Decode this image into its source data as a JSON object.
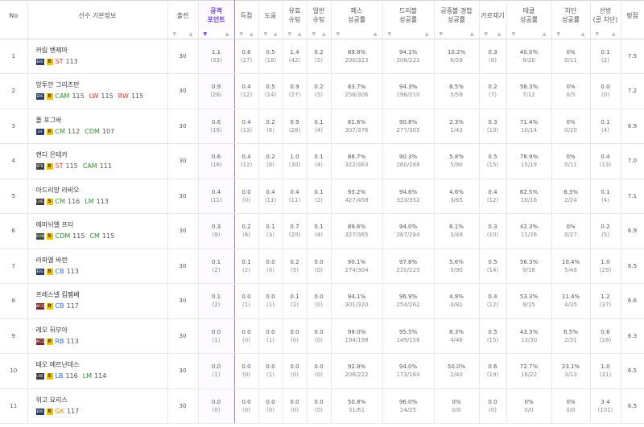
{
  "headers": {
    "no": "No",
    "player": "선수 기본정보",
    "apps": "출전",
    "attack_points": [
      "공격",
      "포인트"
    ],
    "goals": "득점",
    "assists": "도움",
    "shots_on": [
      "유효",
      "슈팅"
    ],
    "shots": [
      "일반",
      "슈팅"
    ],
    "pass": [
      "패스",
      "성공률"
    ],
    "dribble": [
      "드리블",
      "성공률"
    ],
    "aerial": [
      "공중볼 경합",
      "성공률"
    ],
    "intercept": "가로채기",
    "tackle": [
      "태클",
      "성공률"
    ],
    "block": [
      "차단",
      "성공률"
    ],
    "defense": [
      "선방",
      "(골 차단)"
    ],
    "rating": "평점"
  },
  "rows": [
    {
      "no": "1",
      "name": "카림 벤제마",
      "team": "EBS",
      "num": "8",
      "positions": [
        {
          "pos": "ST",
          "ovr": "113",
          "cls": "pos-st"
        }
      ],
      "apps": "30",
      "ap": [
        "1.1",
        "(33)"
      ],
      "g": [
        "0.6",
        "(17)"
      ],
      "a": [
        "0.5",
        "(16)"
      ],
      "so": [
        "1.4",
        "(42)"
      ],
      "s": [
        "0.2",
        "(5)"
      ],
      "pass": [
        "89.8%",
        "290/323"
      ],
      "drb": [
        "94.1%",
        "208/221"
      ],
      "aer": [
        "10.2%",
        "6/59"
      ],
      "int": [
        "0.3",
        "(8)"
      ],
      "tkl": [
        "40.0%",
        "8/20"
      ],
      "blk": [
        "0%",
        "0/11"
      ],
      "def": [
        "0.1",
        "(2)"
      ],
      "rating": "7.5"
    },
    {
      "no": "2",
      "name": "앙투안 그리즈만",
      "team": "EBS",
      "num": "8",
      "positions": [
        {
          "pos": "CAM",
          "ovr": "115",
          "cls": "pos-cm"
        },
        {
          "pos": "LW",
          "ovr": "115",
          "cls": "pos-lw"
        },
        {
          "pos": "RW",
          "ovr": "115",
          "cls": "pos-rw"
        }
      ],
      "apps": "30",
      "ap": [
        "0.9",
        "(26)"
      ],
      "g": [
        "0.4",
        "(12)"
      ],
      "a": [
        "0.5",
        "(14)"
      ],
      "so": [
        "0.9",
        "(27)"
      ],
      "s": [
        "0.2",
        "(5)"
      ],
      "pass": [
        "83.7%",
        "256/306"
      ],
      "drb": [
        "94.3%",
        "198/210"
      ],
      "aer": [
        "8.5%",
        "5/59"
      ],
      "int": [
        "0.2",
        "(7)"
      ],
      "tkl": [
        "58.3%",
        "7/12"
      ],
      "blk": [
        "0%",
        "0/5"
      ],
      "def": [
        "0.0",
        "(0)"
      ],
      "rating": "7.2"
    },
    {
      "no": "3",
      "name": "폴 포그바",
      "team": "LH",
      "num": "8",
      "positions": [
        {
          "pos": "CM",
          "ovr": "112",
          "cls": "pos-cm"
        },
        {
          "pos": "CDM",
          "ovr": "107",
          "cls": "pos-cdm"
        }
      ],
      "apps": "30",
      "ap": [
        "0.6",
        "(19)"
      ],
      "g": [
        "0.4",
        "(13)"
      ],
      "a": [
        "0.2",
        "(6)"
      ],
      "so": [
        "0.9",
        "(28)"
      ],
      "s": [
        "0.1",
        "(4)"
      ],
      "pass": [
        "81.6%",
        "307/376"
      ],
      "drb": [
        "90.8%",
        "277/305"
      ],
      "aer": [
        "2.3%",
        "1/43"
      ],
      "int": [
        "0.3",
        "(10)"
      ],
      "tkl": [
        "71.4%",
        "10/14"
      ],
      "blk": [
        "0%",
        "0/20"
      ],
      "def": [
        "0.1",
        "(4)"
      ],
      "rating": "6.9"
    },
    {
      "no": "4",
      "name": "랜디 은테카",
      "team": "BTB",
      "num": "8",
      "positions": [
        {
          "pos": "ST",
          "ovr": "115",
          "cls": "pos-st"
        },
        {
          "pos": "CAM",
          "ovr": "111",
          "cls": "pos-cm"
        }
      ],
      "apps": "30",
      "ap": [
        "0.6",
        "(18)"
      ],
      "g": [
        "0.4",
        "(12)"
      ],
      "a": [
        "0.2",
        "(6)"
      ],
      "so": [
        "1.0",
        "(30)"
      ],
      "s": [
        "0.1",
        "(4)"
      ],
      "pass": [
        "88.7%",
        "322/363"
      ],
      "drb": [
        "90.3%",
        "260/288"
      ],
      "aer": [
        "5.8%",
        "5/90"
      ],
      "int": [
        "0.5",
        "(15)"
      ],
      "tkl": [
        "78.9%",
        "15/19"
      ],
      "blk": [
        "0%",
        "0/11"
      ],
      "def": [
        "0.4",
        "(13)"
      ],
      "rating": "7.0"
    },
    {
      "no": "5",
      "name": "아드리앙 라비오",
      "team": "LIVE",
      "num": "5",
      "positions": [
        {
          "pos": "CM",
          "ovr": "116",
          "cls": "pos-cm"
        },
        {
          "pos": "LM",
          "ovr": "113",
          "cls": "pos-lm"
        }
      ],
      "apps": "30",
      "ap": [
        "0.4",
        "(11)"
      ],
      "g": [
        "0.0",
        "(0)"
      ],
      "a": [
        "0.4",
        "(11)"
      ],
      "so": [
        "0.4",
        "(11)"
      ],
      "s": [
        "0.1",
        "(2)"
      ],
      "pass": [
        "93.2%",
        "427/458"
      ],
      "drb": [
        "94.6%",
        "333/352"
      ],
      "aer": [
        "4.6%",
        "3/65"
      ],
      "int": [
        "0.4",
        "(12)"
      ],
      "tkl": [
        "62.5%",
        "10/16"
      ],
      "blk": [
        "8.3%",
        "2/24"
      ],
      "def": [
        "0.1",
        "(4)"
      ],
      "rating": "7.1"
    },
    {
      "no": "6",
      "name": "에마뉘엘 프티",
      "team": "ICON",
      "num": "5",
      "positions": [
        {
          "pos": "CDM",
          "ovr": "115",
          "cls": "pos-cdm"
        },
        {
          "pos": "CM",
          "ovr": "115",
          "cls": "pos-cm"
        }
      ],
      "apps": "30",
      "ap": [
        "0.3",
        "(9)"
      ],
      "g": [
        "0.2",
        "(6)"
      ],
      "a": [
        "0.1",
        "(3)"
      ],
      "so": [
        "0.7",
        "(20)"
      ],
      "s": [
        "0.1",
        "(4)"
      ],
      "pass": [
        "89.6%",
        "327/365"
      ],
      "drb": [
        "94.0%",
        "267/284"
      ],
      "aer": [
        "6.1%",
        "3/49"
      ],
      "int": [
        "0.3",
        "(10)"
      ],
      "tkl": [
        "42.3%",
        "11/26"
      ],
      "blk": [
        "0%",
        "0/27"
      ],
      "def": [
        "0.2",
        "(5)"
      ],
      "rating": "6.9"
    },
    {
      "no": "7",
      "name": "라파엘 바란",
      "team": "EBS",
      "num": "8",
      "positions": [
        {
          "pos": "CB",
          "ovr": "113",
          "cls": "pos-cb"
        }
      ],
      "apps": "30",
      "ap": [
        "0.1",
        "(2)"
      ],
      "g": [
        "0.1",
        "(2)"
      ],
      "a": [
        "0.0",
        "(0)"
      ],
      "so": [
        "0.2",
        "(5)"
      ],
      "s": [
        "0.0",
        "(0)"
      ],
      "pass": [
        "90.1%",
        "274/304"
      ],
      "drb": [
        "97.8%",
        "220/225"
      ],
      "aer": [
        "5.6%",
        "5/90"
      ],
      "int": [
        "0.5",
        "(14)"
      ],
      "tkl": [
        "56.3%",
        "9/16"
      ],
      "blk": [
        "10.4%",
        "5/48"
      ],
      "def": [
        "1.0",
        "(29)"
      ],
      "rating": "6.5"
    },
    {
      "no": "8",
      "name": "프레스넬 킴펨베",
      "team": "WC22",
      "num": "8",
      "positions": [
        {
          "pos": "CB",
          "ovr": "117",
          "cls": "pos-cb"
        }
      ],
      "apps": "30",
      "ap": [
        "0.1",
        "(2)"
      ],
      "g": [
        "0.0",
        "(1)"
      ],
      "a": [
        "0.0",
        "(1)"
      ],
      "so": [
        "0.1",
        "(2)"
      ],
      "s": [
        "0.0",
        "(0)"
      ],
      "pass": [
        "94.1%",
        "301/320"
      ],
      "drb": [
        "96.9%",
        "254/262"
      ],
      "aer": [
        "4.9%",
        "4/81"
      ],
      "int": [
        "0.4",
        "(12)"
      ],
      "tkl": [
        "53.3%",
        "8/15"
      ],
      "blk": [
        "11.4%",
        "4/35"
      ],
      "def": [
        "1.2",
        "(37)"
      ],
      "rating": "6.6"
    },
    {
      "no": "9",
      "name": "레오 뒤부아",
      "team": "WC22",
      "num": "8",
      "positions": [
        {
          "pos": "RB",
          "ovr": "113",
          "cls": "pos-rb"
        }
      ],
      "apps": "30",
      "ap": [
        "0.0",
        "(1)"
      ],
      "g": [
        "0.0",
        "(0)"
      ],
      "a": [
        "0.0",
        "(1)"
      ],
      "so": [
        "0.0",
        "(0)"
      ],
      "s": [
        "0.0",
        "(0)"
      ],
      "pass": [
        "98.0%",
        "194/198"
      ],
      "drb": [
        "95.5%",
        "149/156"
      ],
      "aer": [
        "8.3%",
        "4/48"
      ],
      "int": [
        "0.5",
        "(15)"
      ],
      "tkl": [
        "43.3%",
        "13/30"
      ],
      "blk": [
        "6.5%",
        "2/31"
      ],
      "def": [
        "0.6",
        "(18)"
      ],
      "rating": "6.3"
    },
    {
      "no": "10",
      "name": "테오 에르난데스",
      "team": "LIVE",
      "num": "5",
      "positions": [
        {
          "pos": "LB",
          "ovr": "116",
          "cls": "pos-lb"
        },
        {
          "pos": "LM",
          "ovr": "114",
          "cls": "pos-lm"
        }
      ],
      "apps": "30",
      "ap": [
        "0.0",
        "(1)"
      ],
      "g": [
        "0.0",
        "(0)"
      ],
      "a": [
        "0.0",
        "(1)"
      ],
      "so": [
        "0.0",
        "(0)"
      ],
      "s": [
        "0.0",
        "(0)"
      ],
      "pass": [
        "92.8%",
        "206/222"
      ],
      "drb": [
        "94.0%",
        "173/184"
      ],
      "aer": [
        "50.0%",
        "2/40"
      ],
      "int": [
        "0.6",
        "(19)"
      ],
      "tkl": [
        "72.7%",
        "16/22"
      ],
      "blk": [
        "23.1%",
        "3/13"
      ],
      "def": [
        "1.0",
        "(31)"
      ],
      "rating": "6.5"
    },
    {
      "no": "11",
      "name": "위고 요리스",
      "team": "EBS",
      "num": "8",
      "positions": [
        {
          "pos": "GK",
          "ovr": "117",
          "cls": "pos-gk"
        }
      ],
      "apps": "30",
      "ap": [
        "0.0",
        "(0)"
      ],
      "g": [
        "0.0",
        "(0)"
      ],
      "a": [
        "0.0",
        "(0)"
      ],
      "so": [
        "0.0",
        "(0)"
      ],
      "s": [
        "0.0",
        "(0)"
      ],
      "pass": [
        "50.8%",
        "31/61"
      ],
      "drb": [
        "96.0%",
        "24/25"
      ],
      "aer": [
        "0%",
        "0/0"
      ],
      "int": [
        "0.0",
        "(0)"
      ],
      "tkl": [
        "0%",
        "0/0"
      ],
      "blk": [
        "0%",
        "0/0"
      ],
      "def": [
        "3.4",
        "(101)"
      ],
      "rating": "6.5"
    }
  ],
  "sort_icons": {
    "up": "▲",
    "down": "▼"
  },
  "colors": {
    "accent": "#6b3fd4",
    "highlight_border": "#a77be6"
  }
}
